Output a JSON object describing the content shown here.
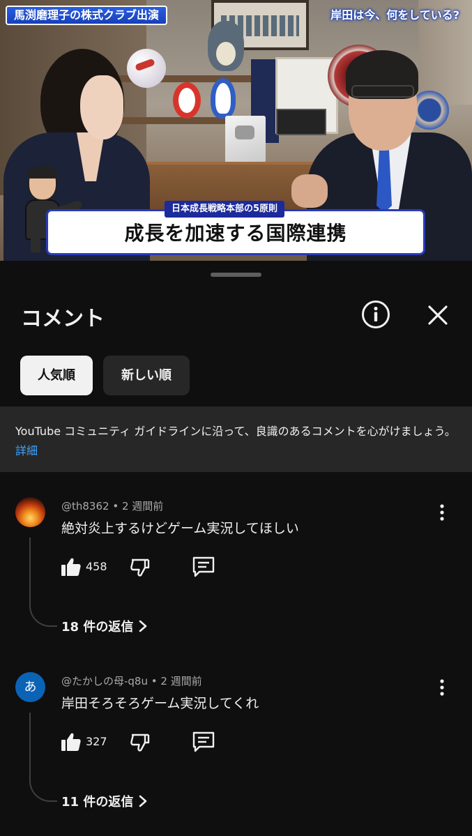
{
  "video": {
    "overlay_left": "馬渕磨理子の株式クラブ出演",
    "overlay_right": "岸田は今、何をしている?",
    "caption_sub": "日本成長戦略本部の5原則",
    "caption_main": "成長を加速する国際連携"
  },
  "sheet": {
    "title": "コメント",
    "sort_options": [
      "人気順",
      "新しい順"
    ],
    "selected_sort": "人気順",
    "guideline_text": "YouTube コミュニティ ガイドラインに沿って、良識のあるコメントを心がけましょう。",
    "guideline_link": "詳細"
  },
  "comments": [
    {
      "author": "@th8362",
      "time": "2 週間前",
      "text": "絶対炎上するけどゲーム実況してほしい",
      "likes": "458",
      "replies_label": "18 件の返信",
      "avatar": "fire-photo"
    },
    {
      "author": "@たかしの母-q8u",
      "time": "2 週間前",
      "text": "岸田そろそろゲーム実況してくれ",
      "likes": "327",
      "replies_label": "11 件の返信",
      "avatar_letter": "あ",
      "avatar_color": "#0b63b6"
    }
  ],
  "colors": {
    "background": "#0f0f0f",
    "chip_inactive": "#272727",
    "link": "#3ea6ff",
    "caption_border": "#2b3ab8"
  },
  "icons": [
    "info-icon",
    "close-icon",
    "more-vert-icon",
    "thumb-up-icon",
    "thumb-down-icon",
    "reply-icon",
    "chevron-right-icon"
  ]
}
